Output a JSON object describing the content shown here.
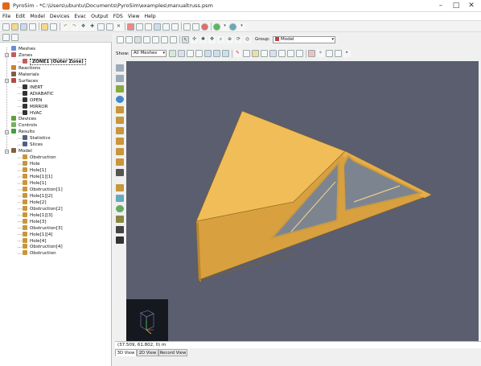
{
  "window": {
    "title": "PyroSim - *C:\\Users\\ubuntu\\Documents\\PyroSim\\examples\\manualtruss.psm"
  },
  "menu": [
    "File",
    "Edit",
    "Model",
    "Devices",
    "Evac",
    "Output",
    "FDS",
    "View",
    "Help"
  ],
  "tree": [
    {
      "label": "Meshes",
      "lvl": 1,
      "color": "#6a8fd0"
    },
    {
      "label": "Zones",
      "lvl": 1,
      "color": "#c45c5c"
    },
    {
      "label": "ZONE1 (Outer Zone)",
      "lvl": 2,
      "color": "#c45c5c",
      "selected": true
    },
    {
      "label": "Reactions",
      "lvl": 1,
      "color": "#d08030"
    },
    {
      "label": "Materials",
      "lvl": 1,
      "color": "#806040"
    },
    {
      "label": "Surfaces",
      "lvl": 1,
      "color": "#b04848"
    },
    {
      "label": "INERT",
      "lvl": 2,
      "color": "#333"
    },
    {
      "label": "ADIABATIC",
      "lvl": 2,
      "color": "#333"
    },
    {
      "label": "OPEN",
      "lvl": 2,
      "color": "#333"
    },
    {
      "label": "MIRROR",
      "lvl": 2,
      "color": "#333"
    },
    {
      "label": "HVAC",
      "lvl": 2,
      "color": "#333"
    },
    {
      "label": "Devices",
      "lvl": 1,
      "color": "#5fa040"
    },
    {
      "label": "Controls",
      "lvl": 1,
      "color": "#7ab060"
    },
    {
      "label": "Results",
      "lvl": 1,
      "color": "#40a040"
    },
    {
      "label": "Statistics",
      "lvl": 2,
      "color": "#506080"
    },
    {
      "label": "Slices",
      "lvl": 2,
      "color": "#506080"
    },
    {
      "label": "Model",
      "lvl": 1,
      "color": "#806040"
    },
    {
      "label": "Obstruction",
      "lvl": 2,
      "color": "#c8963c"
    },
    {
      "label": "Hole",
      "lvl": 2,
      "color": "#c8963c"
    },
    {
      "label": "Hole[1]",
      "lvl": 2,
      "color": "#c8963c"
    },
    {
      "label": "Hole[1][1]",
      "lvl": 2,
      "color": "#c8963c"
    },
    {
      "label": "Hole[1]",
      "lvl": 2,
      "color": "#c8963c"
    },
    {
      "label": "Obstruction[1]",
      "lvl": 2,
      "color": "#c8963c"
    },
    {
      "label": "Hole[1][2]",
      "lvl": 2,
      "color": "#c8963c"
    },
    {
      "label": "Hole[2]",
      "lvl": 2,
      "color": "#c8963c"
    },
    {
      "label": "Obstruction[2]",
      "lvl": 2,
      "color": "#c8963c"
    },
    {
      "label": "Hole[1][3]",
      "lvl": 2,
      "color": "#c8963c"
    },
    {
      "label": "Hole[3]",
      "lvl": 2,
      "color": "#c8963c"
    },
    {
      "label": "Obstruction[3]",
      "lvl": 2,
      "color": "#c8963c"
    },
    {
      "label": "Hole[1][4]",
      "lvl": 2,
      "color": "#c8963c"
    },
    {
      "label": "Hole[4]",
      "lvl": 2,
      "color": "#c8963c"
    },
    {
      "label": "Obstruction[4]",
      "lvl": 2,
      "color": "#c8963c"
    },
    {
      "label": "Obstruction",
      "lvl": 2,
      "color": "#c8963c"
    }
  ],
  "toolbar2": {
    "group_label": "Group:",
    "group_value": "Model"
  },
  "toolbar3": {
    "show_label": "Show:",
    "show_value": "All Meshes"
  },
  "status": {
    "coords": "(37.509, 61.802, 0) m"
  },
  "tabs": [
    "3D View",
    "2D View",
    "Record View"
  ],
  "colors": {
    "roof": "#e8b04c",
    "roof_dark": "#c9923a",
    "background": "#5a5e6e"
  }
}
